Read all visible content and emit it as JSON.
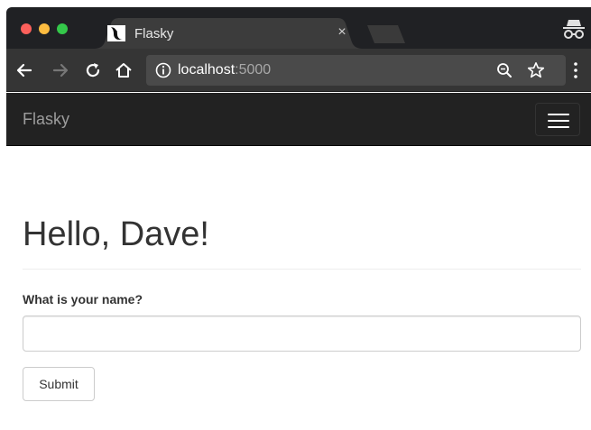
{
  "browser": {
    "tab_title": "Flasky",
    "tab_close": "×",
    "url_host": "localhost",
    "url_port": ":5000"
  },
  "navbar": {
    "brand": "Flasky"
  },
  "page": {
    "heading": "Hello, Dave!",
    "form_label": "What is your name?",
    "name_value": "",
    "submit_label": "Submit"
  },
  "icons": [
    "back-icon",
    "forward-icon",
    "reload-icon",
    "home-icon",
    "info-icon",
    "zoom-icon",
    "star-icon",
    "menu-dots-icon",
    "incognito-icon",
    "hamburger-icon",
    "flask-favicon"
  ]
}
